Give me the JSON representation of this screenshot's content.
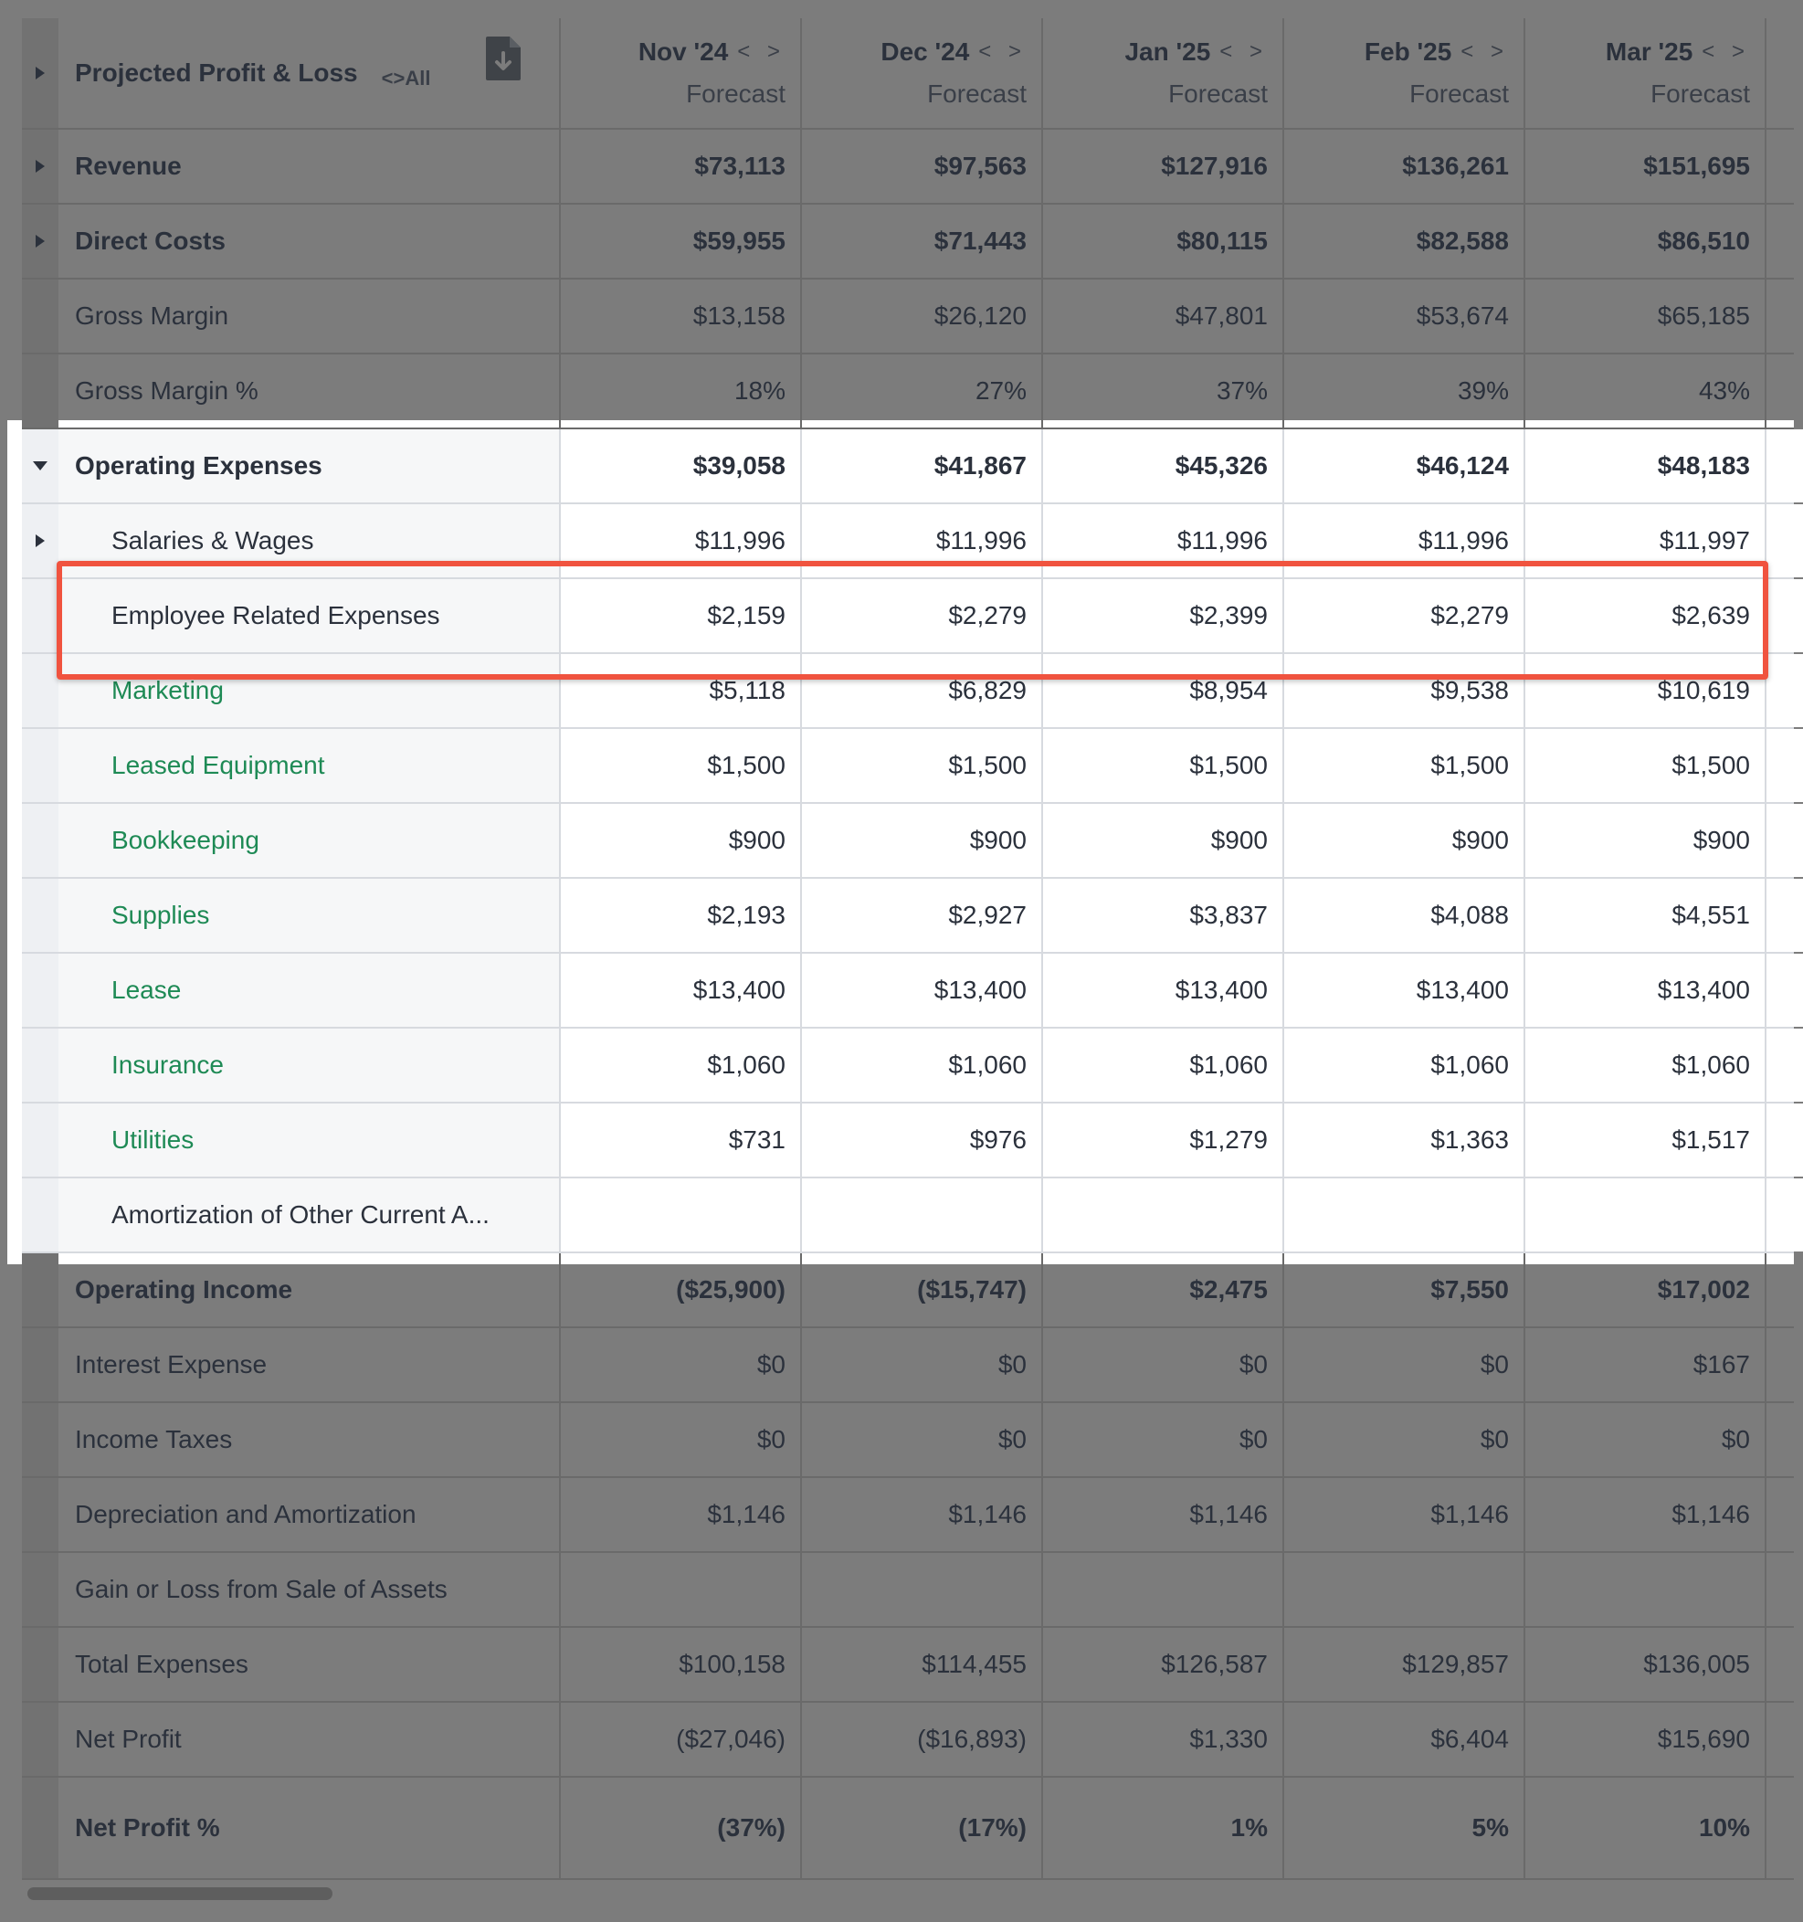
{
  "header": {
    "title": "Projected Profit & Loss",
    "all_toggle": "<>All",
    "columns": [
      {
        "month": "Nov '24",
        "sub": "Forecast"
      },
      {
        "month": "Dec '24",
        "sub": "Forecast"
      },
      {
        "month": "Jan '25",
        "sub": "Forecast"
      },
      {
        "month": "Feb '25",
        "sub": "Forecast"
      },
      {
        "month": "Mar '25",
        "sub": "Forecast"
      }
    ],
    "nav_arrows": "< >"
  },
  "rows": [
    {
      "label": "Revenue",
      "values": [
        "$73,113",
        "$97,563",
        "$127,916",
        "$136,261",
        "$151,695"
      ],
      "bold": true,
      "expander": "right",
      "indent": false,
      "green": false,
      "highlighted": false
    },
    {
      "label": "Direct Costs",
      "values": [
        "$59,955",
        "$71,443",
        "$80,115",
        "$82,588",
        "$86,510"
      ],
      "bold": true,
      "expander": "right",
      "indent": false,
      "green": false,
      "highlighted": false
    },
    {
      "label": "Gross Margin",
      "values": [
        "$13,158",
        "$26,120",
        "$47,801",
        "$53,674",
        "$65,185"
      ],
      "bold": false,
      "expander": "",
      "indent": false,
      "green": false,
      "highlighted": false
    },
    {
      "label": "Gross Margin %",
      "values": [
        "18%",
        "27%",
        "37%",
        "39%",
        "43%"
      ],
      "bold": false,
      "expander": "",
      "indent": false,
      "green": false,
      "highlighted": false
    },
    {
      "label": "Operating Expenses",
      "values": [
        "$39,058",
        "$41,867",
        "$45,326",
        "$46,124",
        "$48,183"
      ],
      "bold": true,
      "expander": "down",
      "indent": false,
      "green": false,
      "highlighted": true
    },
    {
      "label": "Salaries & Wages",
      "values": [
        "$11,996",
        "$11,996",
        "$11,996",
        "$11,996",
        "$11,997"
      ],
      "bold": false,
      "expander": "right",
      "indent": true,
      "green": false,
      "highlighted": true
    },
    {
      "label": "Employee Related Expenses",
      "values": [
        "$2,159",
        "$2,279",
        "$2,399",
        "$2,279",
        "$2,639"
      ],
      "bold": false,
      "expander": "",
      "indent": true,
      "green": false,
      "highlighted": true
    },
    {
      "label": "Marketing",
      "values": [
        "$5,118",
        "$6,829",
        "$8,954",
        "$9,538",
        "$10,619"
      ],
      "bold": false,
      "expander": "",
      "indent": true,
      "green": true,
      "highlighted": true
    },
    {
      "label": "Leased Equipment",
      "values": [
        "$1,500",
        "$1,500",
        "$1,500",
        "$1,500",
        "$1,500"
      ],
      "bold": false,
      "expander": "",
      "indent": true,
      "green": true,
      "highlighted": true
    },
    {
      "label": "Bookkeeping",
      "values": [
        "$900",
        "$900",
        "$900",
        "$900",
        "$900"
      ],
      "bold": false,
      "expander": "",
      "indent": true,
      "green": true,
      "highlighted": true
    },
    {
      "label": "Supplies",
      "values": [
        "$2,193",
        "$2,927",
        "$3,837",
        "$4,088",
        "$4,551"
      ],
      "bold": false,
      "expander": "",
      "indent": true,
      "green": true,
      "highlighted": true
    },
    {
      "label": "Lease",
      "values": [
        "$13,400",
        "$13,400",
        "$13,400",
        "$13,400",
        "$13,400"
      ],
      "bold": false,
      "expander": "",
      "indent": true,
      "green": true,
      "highlighted": true
    },
    {
      "label": "Insurance",
      "values": [
        "$1,060",
        "$1,060",
        "$1,060",
        "$1,060",
        "$1,060"
      ],
      "bold": false,
      "expander": "",
      "indent": true,
      "green": true,
      "highlighted": true
    },
    {
      "label": "Utilities",
      "values": [
        "$731",
        "$976",
        "$1,279",
        "$1,363",
        "$1,517"
      ],
      "bold": false,
      "expander": "",
      "indent": true,
      "green": true,
      "highlighted": true
    },
    {
      "label": "Amortization of Other Current A...",
      "values": [
        "",
        "",
        "",
        "",
        ""
      ],
      "bold": false,
      "expander": "",
      "indent": true,
      "green": false,
      "highlighted": true
    },
    {
      "label": "Operating Income",
      "values": [
        "($25,900)",
        "($15,747)",
        "$2,475",
        "$7,550",
        "$17,002"
      ],
      "bold": true,
      "expander": "",
      "indent": false,
      "green": false,
      "highlighted": false
    },
    {
      "label": "Interest Expense",
      "values": [
        "$0",
        "$0",
        "$0",
        "$0",
        "$167"
      ],
      "bold": false,
      "expander": "",
      "indent": false,
      "green": false,
      "highlighted": false
    },
    {
      "label": "Income Taxes",
      "values": [
        "$0",
        "$0",
        "$0",
        "$0",
        "$0"
      ],
      "bold": false,
      "expander": "",
      "indent": false,
      "green": false,
      "highlighted": false
    },
    {
      "label": "Depreciation and Amortization",
      "values": [
        "$1,146",
        "$1,146",
        "$1,146",
        "$1,146",
        "$1,146"
      ],
      "bold": false,
      "expander": "",
      "indent": false,
      "green": false,
      "highlighted": false
    },
    {
      "label": "Gain or Loss from Sale of Assets",
      "values": [
        "",
        "",
        "",
        "",
        ""
      ],
      "bold": false,
      "expander": "",
      "indent": false,
      "green": false,
      "highlighted": false
    },
    {
      "label": "Total Expenses",
      "values": [
        "$100,158",
        "$114,455",
        "$126,587",
        "$129,857",
        "$136,005"
      ],
      "bold": false,
      "expander": "",
      "indent": false,
      "green": false,
      "highlighted": false
    },
    {
      "label": "Net Profit",
      "values": [
        "($27,046)",
        "($16,893)",
        "$1,330",
        "$6,404",
        "$15,690"
      ],
      "bold": false,
      "expander": "",
      "indent": false,
      "green": false,
      "highlighted": false
    },
    {
      "label": "Net Profit %",
      "values": [
        "(37%)",
        "(17%)",
        "1%",
        "5%",
        "10%"
      ],
      "bold": true,
      "expander": "",
      "indent": false,
      "green": false,
      "highlighted": false
    }
  ],
  "colors": {
    "accent_green": "#1e8a55",
    "highlight_border": "#f0533f",
    "overlay_gray": "#7c7c7c"
  }
}
